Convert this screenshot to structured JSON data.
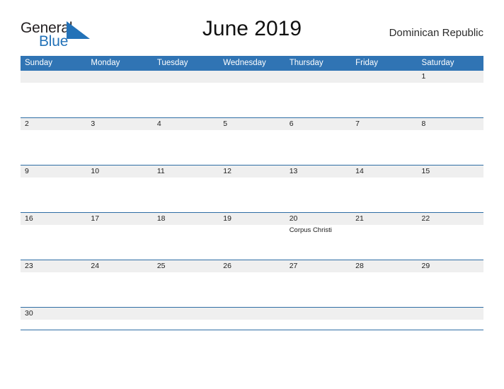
{
  "brand": {
    "logo_text_primary": "General",
    "logo_text_secondary": "Blue",
    "logo_triangle_icon": "triangle-icon",
    "primary_color": "#2372b8",
    "header_blue": "#3074b4",
    "divider_blue": "#2e6da4",
    "band_gray": "#efefef"
  },
  "header": {
    "title": "June 2019",
    "region": "Dominican Republic"
  },
  "calendar": {
    "weekdays": [
      "Sunday",
      "Monday",
      "Tuesday",
      "Wednesday",
      "Thursday",
      "Friday",
      "Saturday"
    ],
    "weeks": [
      {
        "days": [
          {
            "number": "",
            "events": []
          },
          {
            "number": "",
            "events": []
          },
          {
            "number": "",
            "events": []
          },
          {
            "number": "",
            "events": []
          },
          {
            "number": "",
            "events": []
          },
          {
            "number": "",
            "events": []
          },
          {
            "number": "1",
            "events": []
          }
        ]
      },
      {
        "days": [
          {
            "number": "2",
            "events": []
          },
          {
            "number": "3",
            "events": []
          },
          {
            "number": "4",
            "events": []
          },
          {
            "number": "5",
            "events": []
          },
          {
            "number": "6",
            "events": []
          },
          {
            "number": "7",
            "events": []
          },
          {
            "number": "8",
            "events": []
          }
        ]
      },
      {
        "days": [
          {
            "number": "9",
            "events": []
          },
          {
            "number": "10",
            "events": []
          },
          {
            "number": "11",
            "events": []
          },
          {
            "number": "12",
            "events": []
          },
          {
            "number": "13",
            "events": []
          },
          {
            "number": "14",
            "events": []
          },
          {
            "number": "15",
            "events": []
          }
        ]
      },
      {
        "days": [
          {
            "number": "16",
            "events": []
          },
          {
            "number": "17",
            "events": []
          },
          {
            "number": "18",
            "events": []
          },
          {
            "number": "19",
            "events": []
          },
          {
            "number": "20",
            "events": [
              "Corpus Christi"
            ]
          },
          {
            "number": "21",
            "events": []
          },
          {
            "number": "22",
            "events": []
          }
        ]
      },
      {
        "days": [
          {
            "number": "23",
            "events": []
          },
          {
            "number": "24",
            "events": []
          },
          {
            "number": "25",
            "events": []
          },
          {
            "number": "26",
            "events": []
          },
          {
            "number": "27",
            "events": []
          },
          {
            "number": "28",
            "events": []
          },
          {
            "number": "29",
            "events": []
          }
        ]
      },
      {
        "days": [
          {
            "number": "30",
            "events": []
          },
          {
            "number": "",
            "events": []
          },
          {
            "number": "",
            "events": []
          },
          {
            "number": "",
            "events": []
          },
          {
            "number": "",
            "events": []
          },
          {
            "number": "",
            "events": []
          },
          {
            "number": "",
            "events": []
          }
        ]
      }
    ]
  }
}
